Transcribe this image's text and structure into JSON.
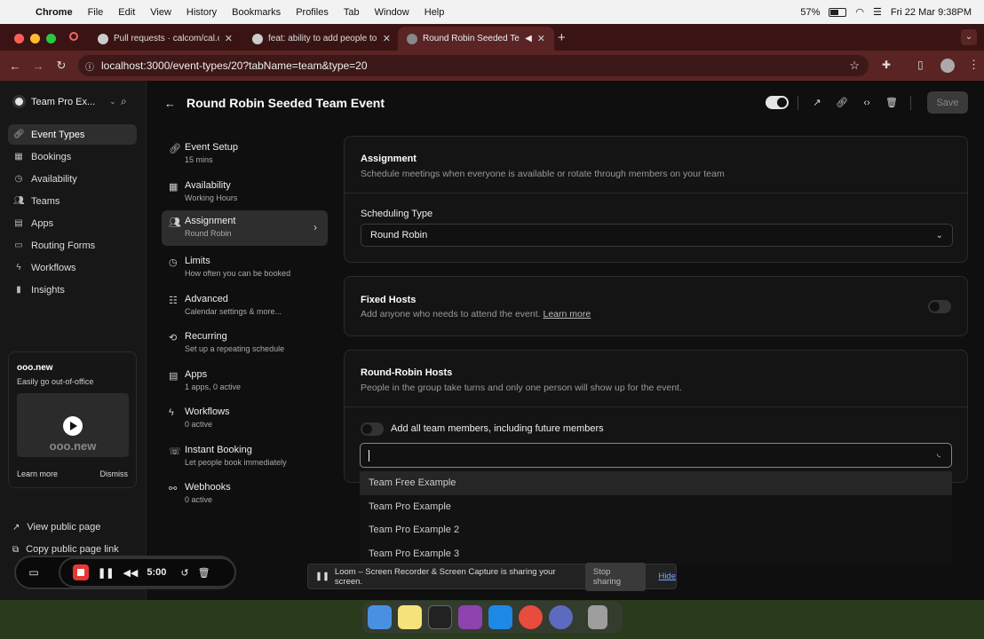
{
  "menubar": {
    "app": "Chrome",
    "items": [
      "File",
      "Edit",
      "View",
      "History",
      "Bookmarks",
      "Profiles",
      "Tab",
      "Window",
      "Help"
    ],
    "battery": "57%",
    "datetime": "Fri 22 Mar  9:38PM"
  },
  "tabs": [
    {
      "title": "Pull requests · calcom/cal.com"
    },
    {
      "title": "feat: ability to add people to t"
    },
    {
      "title": "Round Robin Seeded Team"
    }
  ],
  "url": "localhost:3000/event-types/20?tabName=team&type=20",
  "sidebar": {
    "team": "Team Pro Ex...",
    "items": [
      {
        "label": "Event Types",
        "icon": "link-icon"
      },
      {
        "label": "Bookings",
        "icon": "calendar-icon"
      },
      {
        "label": "Availability",
        "icon": "clock-icon"
      },
      {
        "label": "Teams",
        "icon": "users-icon"
      },
      {
        "label": "Apps",
        "icon": "grid-icon"
      },
      {
        "label": "Routing Forms",
        "icon": "file-icon"
      },
      {
        "label": "Workflows",
        "icon": "zap-icon"
      },
      {
        "label": "Insights",
        "icon": "bar-chart-icon"
      }
    ],
    "promo": {
      "title": "ooo.new",
      "desc": "Easily go out-of-office",
      "brand": "ooo.new",
      "learn": "Learn more",
      "dismiss": "Dismiss"
    },
    "view_public": "View public page",
    "copy_public": "Copy public page link"
  },
  "header": {
    "title": "Round Robin Seeded Team Event",
    "save": "Save"
  },
  "vnav": [
    {
      "label": "Event Setup",
      "sub": "15 mins"
    },
    {
      "label": "Availability",
      "sub": "Working Hours"
    },
    {
      "label": "Assignment",
      "sub": "Round Robin"
    },
    {
      "label": "Limits",
      "sub": "How often you can be booked"
    },
    {
      "label": "Advanced",
      "sub": "Calendar settings & more..."
    },
    {
      "label": "Recurring",
      "sub": "Set up a repeating schedule"
    },
    {
      "label": "Apps",
      "sub": "1 apps, 0 active"
    },
    {
      "label": "Workflows",
      "sub": "0 active"
    },
    {
      "label": "Instant Booking",
      "sub": "Let people book immediately"
    },
    {
      "label": "Webhooks",
      "sub": "0 active"
    }
  ],
  "assignment": {
    "title": "Assignment",
    "sub": "Schedule meetings when everyone is available or rotate through members on your team",
    "sched_label": "Scheduling Type",
    "sched_value": "Round Robin"
  },
  "fixed": {
    "title": "Fixed Hosts",
    "sub": "Add anyone who needs to attend the event.",
    "link": "Learn more"
  },
  "rr": {
    "title": "Round-Robin Hosts",
    "sub": "People in the group take turns and only one person will show up for the event.",
    "toggle_label": "Add all team members, including future members",
    "options": [
      "Team Free Example",
      "Team Pro Example",
      "Team Pro Example 2",
      "Team Pro Example 3"
    ]
  },
  "recorder": {
    "time": "5:00"
  },
  "share": {
    "text": "Loom – Screen Recorder & Screen Capture is sharing your screen.",
    "stop": "Stop sharing",
    "hide": "Hide"
  }
}
